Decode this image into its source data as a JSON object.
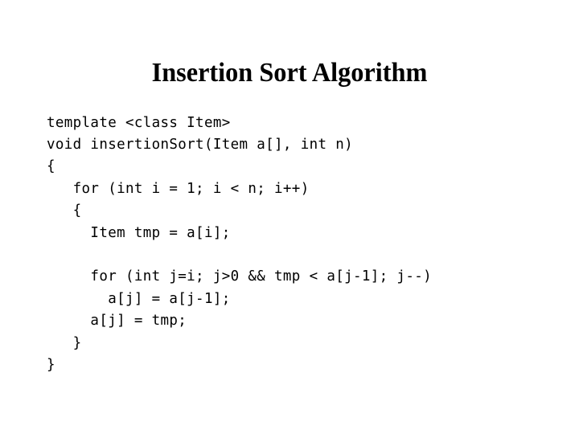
{
  "slide": {
    "title": "Insertion Sort Algorithm",
    "background_color": "#ffffff",
    "text_color": "#000000"
  },
  "code": {
    "language": "cpp",
    "lines": [
      "template <class Item>",
      "void insertionSort(Item a[], int n)",
      "{",
      "   for (int i = 1; i < n; i++)",
      "   {",
      "     Item tmp = a[i];",
      "",
      "     for (int j=i; j>0 && tmp < a[j-1]; j--)",
      "       a[j] = a[j-1];",
      "     a[j] = tmp;",
      "   }",
      "}"
    ]
  }
}
